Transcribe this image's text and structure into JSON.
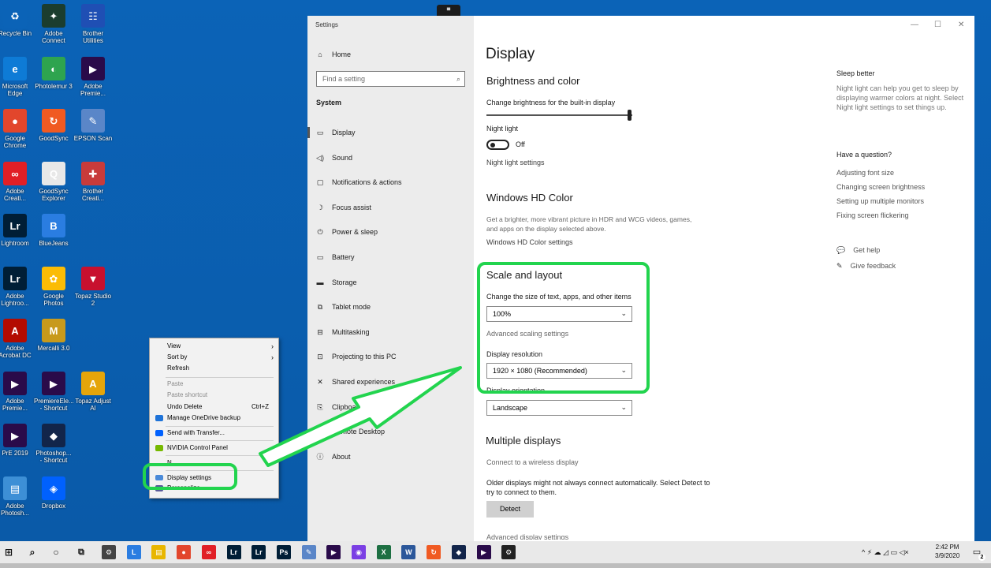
{
  "desktop": {
    "icons": [
      {
        "label": "Recycle Bin",
        "glyph": "♻",
        "color": "#0b63b7"
      },
      {
        "label": "Adobe\nConnect",
        "glyph": "✦",
        "color": "#1b3d2e"
      },
      {
        "label": "Brother\nUtilities",
        "glyph": "☷",
        "color": "#1f4fb4"
      },
      {
        "label": "Microsoft\nEdge",
        "glyph": "e",
        "color": "#0e7bd6"
      },
      {
        "label": "Photolemur 3",
        "glyph": "◐",
        "color": "#2ea44f"
      },
      {
        "label": "Adobe\nPremie...",
        "glyph": "▶",
        "color": "#2a0b4a"
      },
      {
        "label": "Google\nChrome",
        "glyph": "●",
        "color": "#e2462c"
      },
      {
        "label": "GoodSync",
        "glyph": "↻",
        "color": "#f05a22"
      },
      {
        "label": "EPSON Scan",
        "glyph": "✎",
        "color": "#5a86c8"
      },
      {
        "label": "Adobe\nCreati...",
        "glyph": "∞",
        "color": "#e11f26"
      },
      {
        "label": "GoodSync\nExplorer",
        "glyph": "Q",
        "color": "#e8e8e8"
      },
      {
        "label": "Brother\nCreati...",
        "glyph": "✚",
        "color": "#c83b3b"
      },
      {
        "label": "Lightroom",
        "glyph": "Lr",
        "color": "#001e36"
      },
      {
        "label": "BlueJeans",
        "glyph": "B",
        "color": "#2a7de1"
      },
      {
        "label": "Adobe\nLightroo...",
        "glyph": "Lr",
        "color": "#001e36"
      },
      {
        "label": "Google\nPhotos",
        "glyph": "✿",
        "color": "#fbbc05"
      },
      {
        "label": "Topaz Studio\n2",
        "glyph": "▼",
        "color": "#c8102e"
      },
      {
        "label": "Adobe\nAcrobat DC",
        "glyph": "A",
        "color": "#b30b00"
      },
      {
        "label": "Mercalli 3.0",
        "glyph": "M",
        "color": "#c89a1c"
      },
      {
        "label": "Adobe\nPremie...",
        "glyph": "▶",
        "color": "#2a0b4a"
      },
      {
        "label": "PremiereEle...\n- Shortcut",
        "glyph": "▶",
        "color": "#2a0b4a"
      },
      {
        "label": "Topaz Adjust\nAI",
        "glyph": "A",
        "color": "#e5a50a"
      },
      {
        "label": "PrE 2019",
        "glyph": "▶",
        "color": "#2a0b4a"
      },
      {
        "label": "Photoshop...\n- Shortcut",
        "glyph": "◆",
        "color": "#12254a"
      },
      {
        "label": "Adobe\nPhotosh...",
        "glyph": "▤",
        "color": "#3d8fd6"
      },
      {
        "label": "Dropbox",
        "glyph": "◈",
        "color": "#0061fe"
      }
    ]
  },
  "context_menu": {
    "view": "View",
    "sort_by": "Sort by",
    "refresh": "Refresh",
    "paste": "Paste",
    "paste_shortcut": "Paste shortcut",
    "undo_delete": "Undo Delete",
    "undo_shortcut": "Ctrl+Z",
    "onedrive": "Manage OneDrive backup",
    "transfer": "Send with Transfer...",
    "nvidia": "NVIDIA Control Panel",
    "new": "N",
    "display_settings": "Display settings",
    "personalize": "Personalize"
  },
  "settings": {
    "window_title": "Settings",
    "sidebar": {
      "home": "Home",
      "search_placeholder": "Find a setting",
      "section": "System",
      "items": [
        {
          "label": "Display",
          "icon": "▭"
        },
        {
          "label": "Sound",
          "icon": "◁)"
        },
        {
          "label": "Notifications & actions",
          "icon": "▢"
        },
        {
          "label": "Focus assist",
          "icon": "☽"
        },
        {
          "label": "Power & sleep",
          "icon": "⏻"
        },
        {
          "label": "Battery",
          "icon": "▭"
        },
        {
          "label": "Storage",
          "icon": "▬"
        },
        {
          "label": "Tablet mode",
          "icon": "⧉"
        },
        {
          "label": "Multitasking",
          "icon": "⊟"
        },
        {
          "label": "Projecting to this PC",
          "icon": "⊡"
        },
        {
          "label": "Shared experiences",
          "icon": "✕"
        },
        {
          "label": "Clipboard",
          "icon": "⎘"
        },
        {
          "label": "Remote Desktop",
          "icon": "⇆"
        },
        {
          "label": "About",
          "icon": "ⓘ"
        }
      ]
    },
    "main": {
      "title": "Display",
      "brightness_header": "Brightness and color",
      "brightness_label": "Change brightness for the built-in display",
      "brightness_value": 1.0,
      "night_light_label": "Night light",
      "night_light_state": "Off",
      "night_light_settings": "Night light settings",
      "hdr_header": "Windows HD Color",
      "hdr_desc_line1": "Get a brighter, more vibrant picture in HDR and WCG videos, games,",
      "hdr_desc_line2": "and apps on the display selected above.",
      "hdr_settings": "Windows HD Color settings",
      "scale_header": "Scale and layout",
      "scale_label": "Change the size of text, apps, and other items",
      "scale_value": "100%",
      "advanced_scaling": "Advanced scaling settings",
      "resolution_label": "Display resolution",
      "resolution_value": "1920 × 1080 (Recommended)",
      "orientation_label": "Display orientation",
      "orientation_value": "Landscape",
      "multiple_header": "Multiple displays",
      "wireless": "Connect to a wireless display",
      "older_line1": "Older displays might not always connect automatically. Select Detect to",
      "older_line2": "try to connect to them.",
      "detect_button": "Detect",
      "advanced_display": "Advanced display settings"
    },
    "right": {
      "sleep_header": "Sleep better",
      "sleep_text": "Night light can help you get to sleep by displaying warmer colors at night. Select Night light settings to set things up.",
      "question_header": "Have a question?",
      "links": [
        "Adjusting font size",
        "Changing screen brightness",
        "Setting up multiple monitors",
        "Fixing screen flickering"
      ],
      "get_help": "Get help",
      "give_feedback": "Give feedback"
    },
    "window_controls": {
      "minimize": "—",
      "maximize": "☐",
      "close": "✕"
    }
  },
  "taskbar": {
    "time": "2:42 PM",
    "date": "3/9/2020",
    "notification_count": "2",
    "tray_icons": "^ ⚡ ☁ ◿ ▭ ◁×",
    "apps": [
      {
        "glyph": "⚙",
        "color": "#444"
      },
      {
        "glyph": "L",
        "color": "#2a7de1"
      },
      {
        "glyph": "▤",
        "color": "#e8b600"
      },
      {
        "glyph": "●",
        "color": "#e2462c"
      },
      {
        "glyph": "∞",
        "color": "#e11f26"
      },
      {
        "glyph": "Lr",
        "color": "#001e36"
      },
      {
        "glyph": "Lr",
        "color": "#001e36"
      },
      {
        "glyph": "Ps",
        "color": "#001e36"
      },
      {
        "glyph": "✎",
        "color": "#5a86c8"
      },
      {
        "glyph": "▶",
        "color": "#2a0b4a"
      },
      {
        "glyph": "◉",
        "color": "#7b3fe4"
      },
      {
        "glyph": "X",
        "color": "#1d6f42"
      },
      {
        "glyph": "W",
        "color": "#2b579a"
      },
      {
        "glyph": "↻",
        "color": "#f05a22"
      },
      {
        "glyph": "◆",
        "color": "#12254a"
      },
      {
        "glyph": "▶",
        "color": "#2a0b4a"
      },
      {
        "glyph": "⚙",
        "color": "#222"
      }
    ]
  },
  "colors": {
    "desktop_bg": "#0b63b7",
    "highlight": "#22d44e",
    "taskbar_bg": "#e9e9e9",
    "sidebar_bg": "#ececec"
  }
}
